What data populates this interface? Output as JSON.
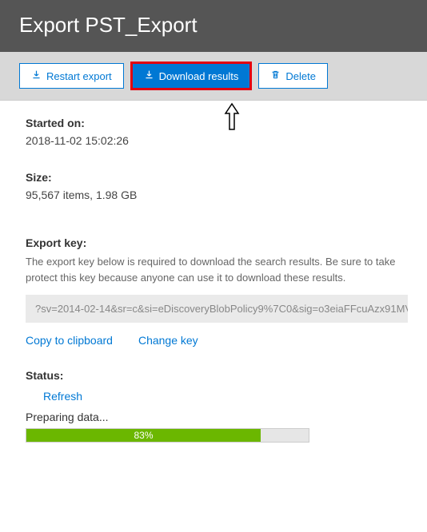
{
  "header": {
    "title": "Export PST_Export"
  },
  "toolbar": {
    "restart_label": "Restart export",
    "download_label": "Download results",
    "delete_label": "Delete"
  },
  "details": {
    "started_label": "Started on:",
    "started_value": "2018-11-02 15:02:26",
    "size_label": "Size:",
    "size_value": "95,567 items, 1.98 GB",
    "export_key_label": "Export key:",
    "export_key_desc": "The export key below is required to download the search results. Be sure to take protect this key because anyone can use it to download these results.",
    "export_key_value": "?sv=2014-02-14&sr=c&si=eDiscoveryBlobPolicy9%7C0&sig=o3eiaFFcuAzx91MV",
    "copy_label": "Copy to clipboard",
    "change_key_label": "Change key",
    "status_label": "Status:",
    "refresh_label": "Refresh",
    "status_text": "Preparing data...",
    "progress_percent": "83%",
    "progress_width": "83%"
  }
}
